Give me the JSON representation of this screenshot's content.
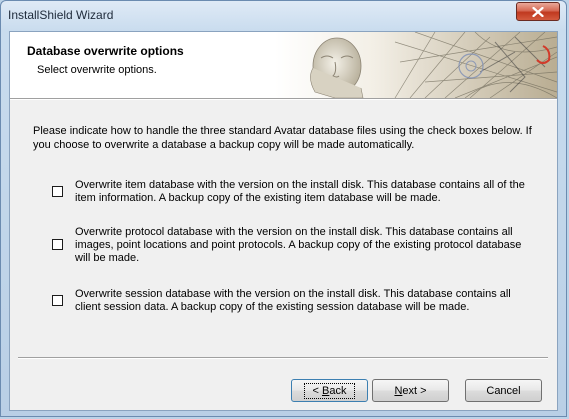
{
  "window": {
    "title": "InstallShield Wizard",
    "close_icon": "close-icon"
  },
  "header": {
    "title": "Database overwrite options",
    "subtitle": "Select overwrite options."
  },
  "body": {
    "intro": "Please indicate how to handle the three standard Avatar database files using the check boxes below. If you choose to overwrite a database a backup copy will be made automatically."
  },
  "options": [
    {
      "label": "Overwrite item database with the version on the install disk. This database contains all of the item information. A backup copy of the existing item database will be made.",
      "checked": false
    },
    {
      "label": "Overwrite protocol database with the version on the install disk. This database contains all images, point locations and point protocols. A backup copy of the existing protocol database will be made.",
      "checked": false
    },
    {
      "label": "Overwrite session database with the version on the install disk. This database contains all client session data. A backup copy of the existing session database will be made.",
      "checked": false
    }
  ],
  "buttons": {
    "back_prefix": "< ",
    "back_key": "B",
    "back_rest": "ack",
    "next_key": "N",
    "next_rest": "ext >",
    "cancel": "Cancel"
  },
  "colors": {
    "window_frame": "#b9cfe6",
    "close_button": "#c0391f",
    "header_bg": "#ffffff",
    "client_bg": "#f0f0f0"
  }
}
